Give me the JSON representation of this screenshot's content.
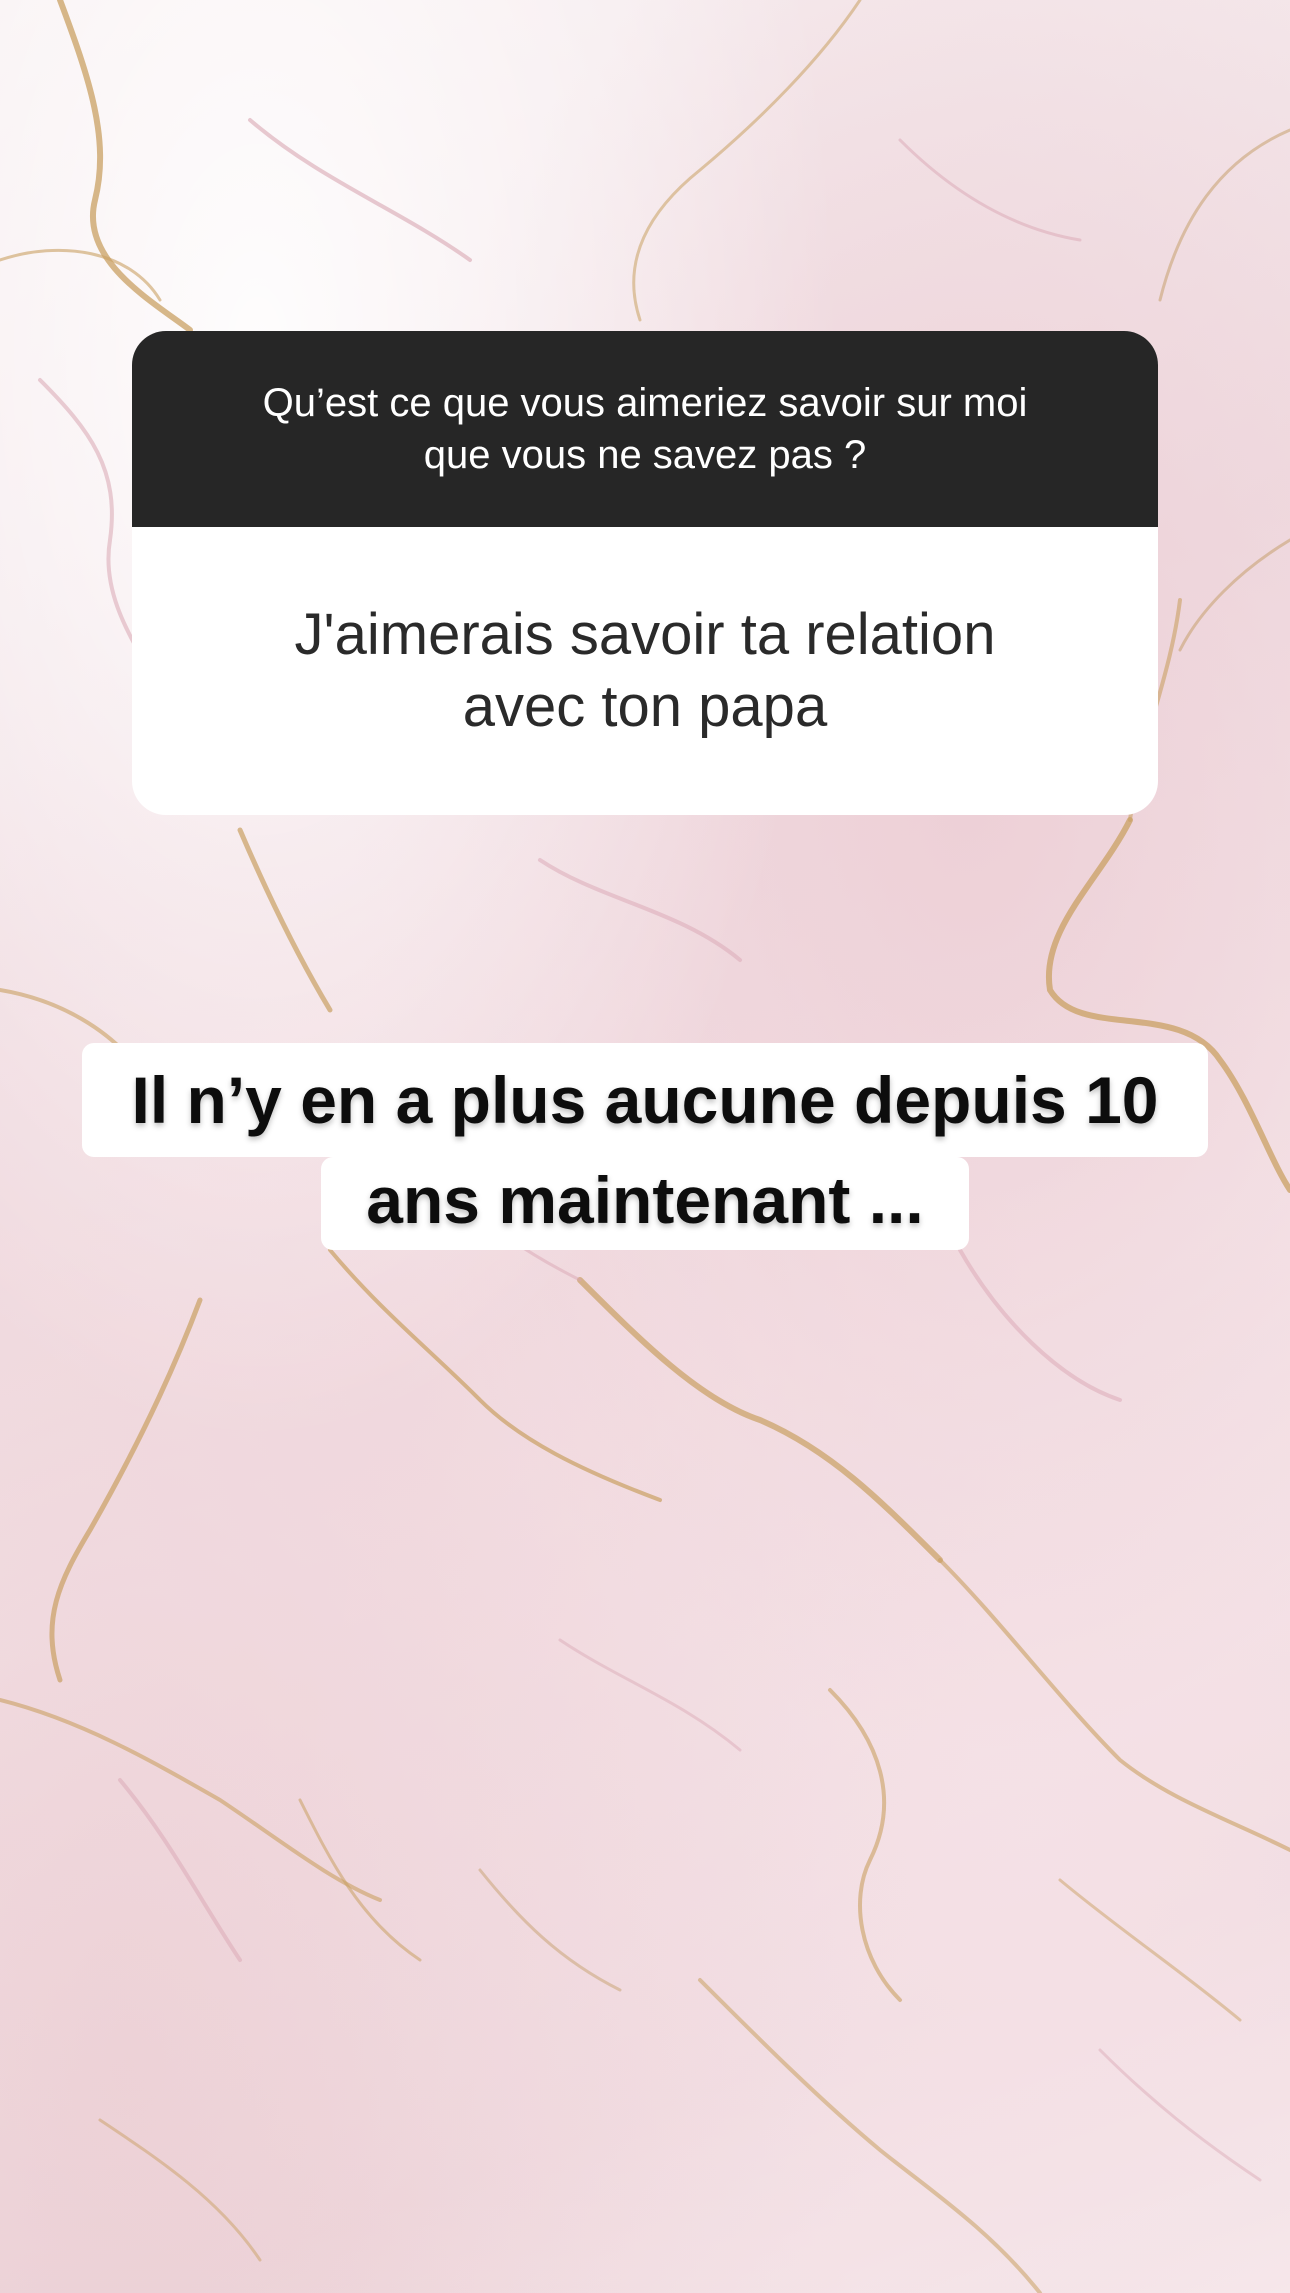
{
  "story": {
    "question_box": {
      "question": "Qu’est ce que vous aimeriez savoir sur moi que vous ne savez pas ?",
      "answer": "J'aimerais savoir ta relation avec ton papa"
    },
    "caption": {
      "line1": "Il n’y en a plus aucune depuis 10",
      "line2": "ans maintenant ..."
    }
  }
}
